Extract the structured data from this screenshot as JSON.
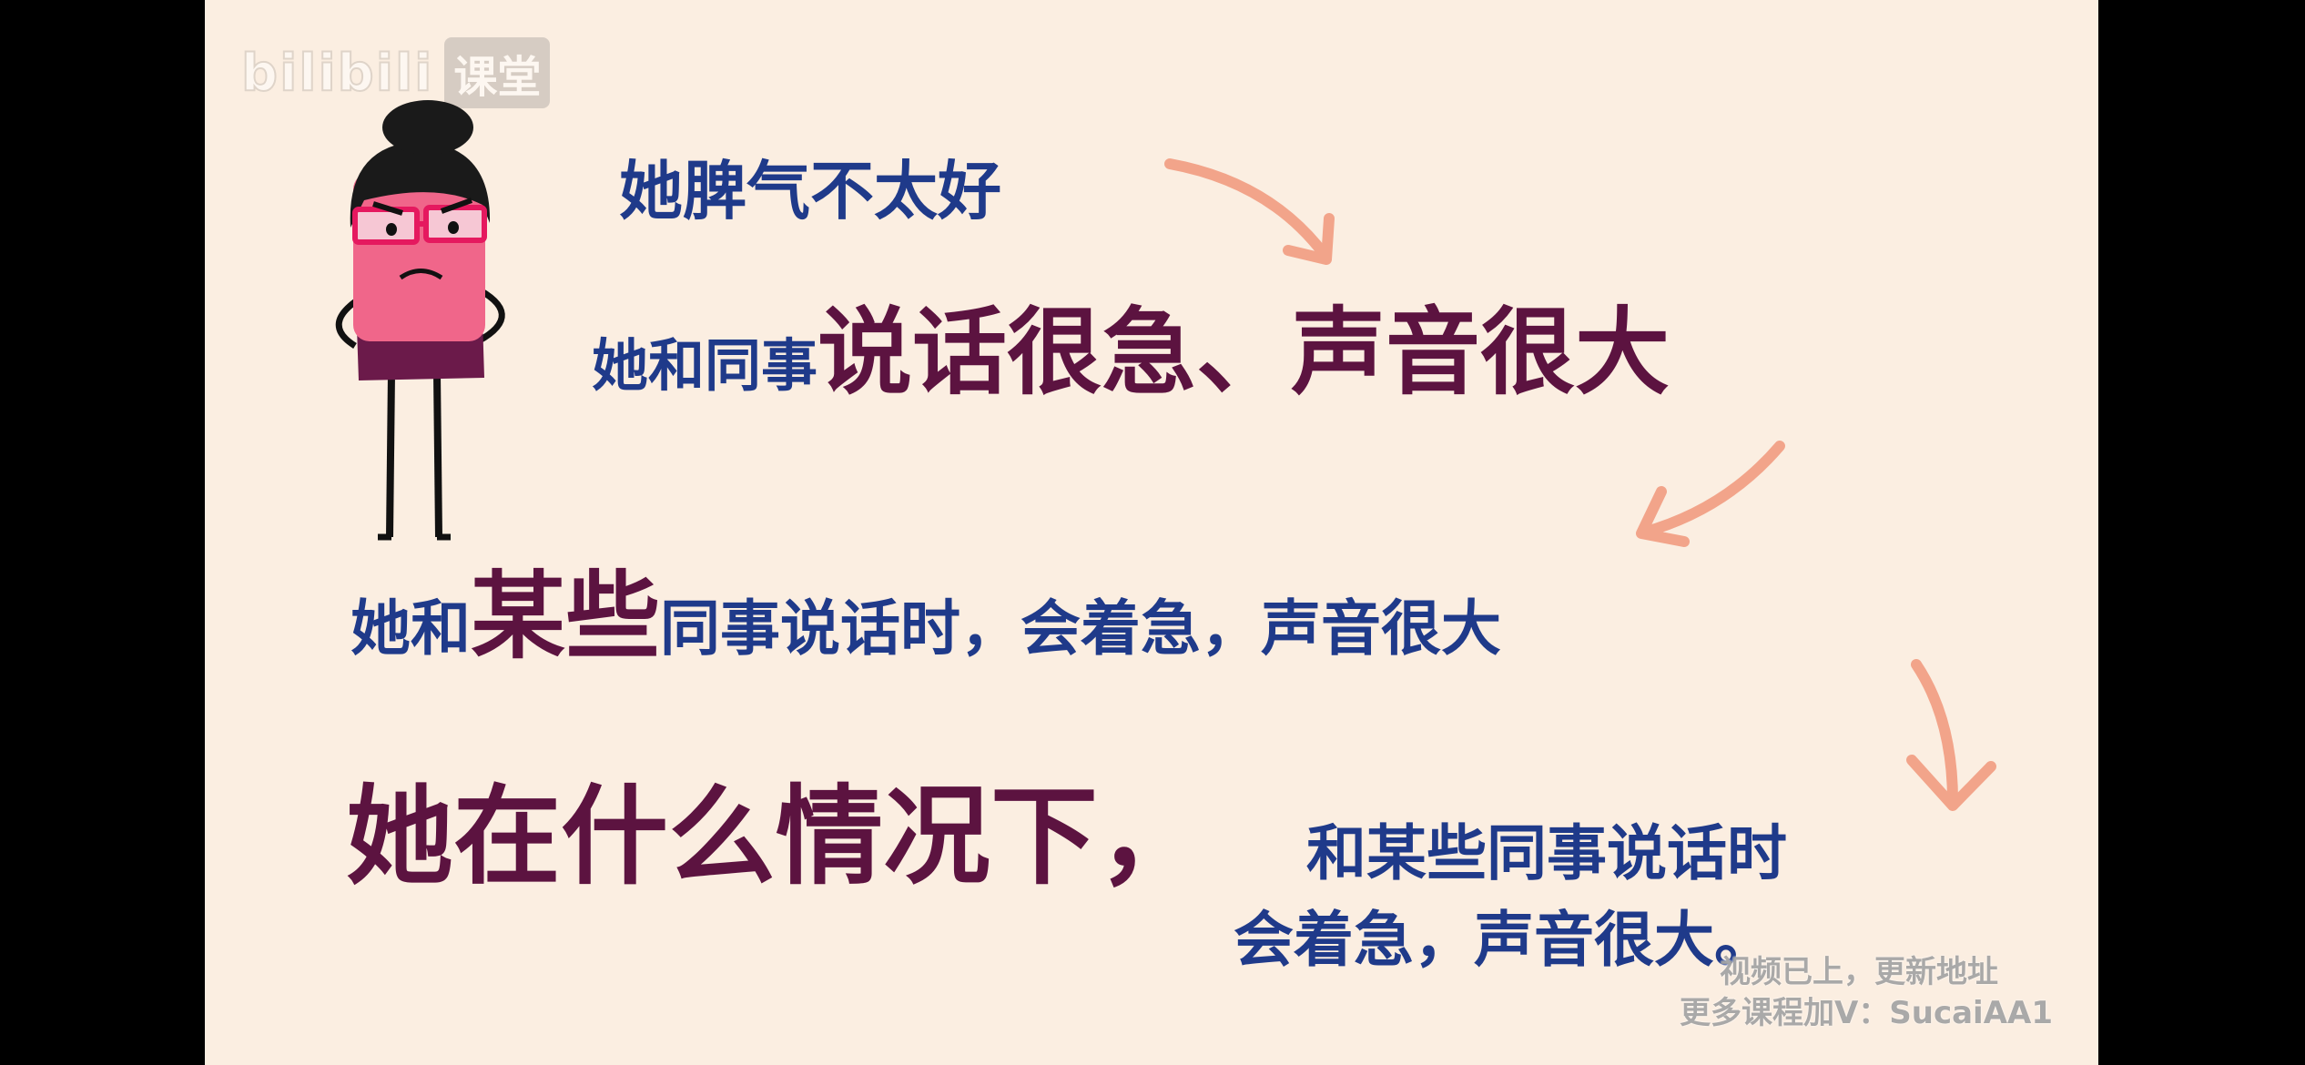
{
  "logo": {
    "brand": "bilibili",
    "channel": "课堂"
  },
  "lines": {
    "line1": "她脾气不太好",
    "line2_prefix": "她和同事",
    "line2_emph": "说话很急、声音很大",
    "line3_prefix": "她和",
    "line3_emph": "某些",
    "line3_suffix": "同事说话时，会着急，声音很大",
    "line4_emph": "她在什么情况下，",
    "line4_sub1": "和某些同事说话时",
    "line4_sub2": "会着急，声音很大。"
  },
  "watermark": {
    "line1": "视频已上，更新地址",
    "line2": "更多课程加V：SucaiAA1"
  },
  "colors": {
    "background": "#fbeee1",
    "blue_text": "#1f3a8a",
    "purple_text": "#5c1340",
    "arrow": "#f2a48a",
    "face": "#f0668a",
    "glasses": "#e5195f",
    "shirt": "#6b1a4a"
  },
  "icons": [
    "bilibili-logo-icon",
    "character-illustration",
    "curved-arrow-icon"
  ]
}
